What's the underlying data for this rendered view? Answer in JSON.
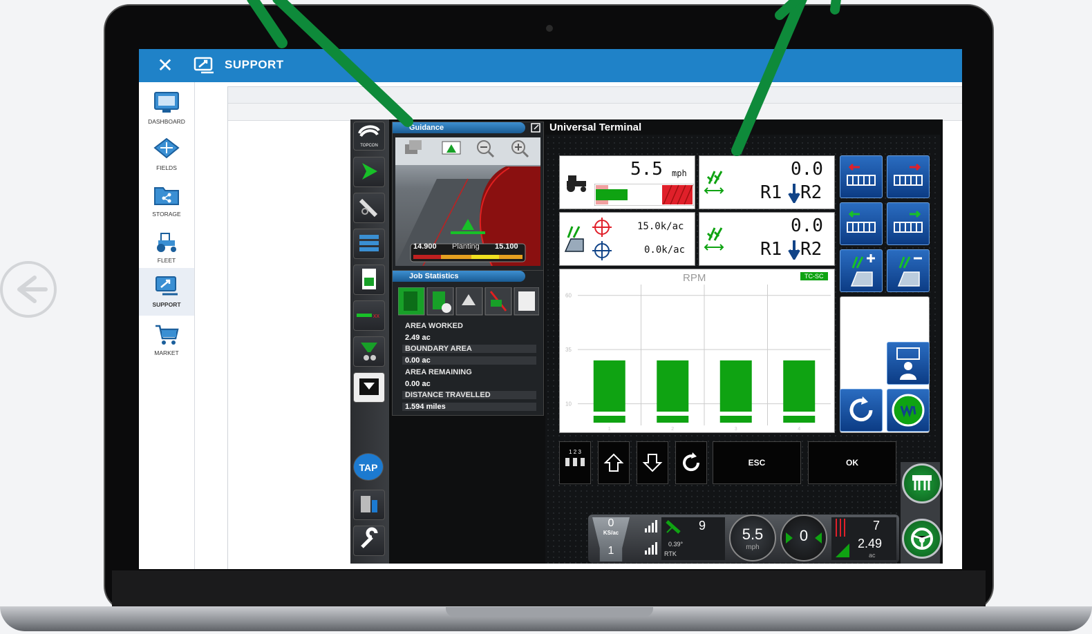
{
  "app": {
    "title": "SUPPORT",
    "sidebar": [
      {
        "label": "DASHBOARD",
        "icon": "monitor-icon"
      },
      {
        "label": "FIELDS",
        "icon": "fields-icon"
      },
      {
        "label": "STORAGE",
        "icon": "folder-share-icon"
      },
      {
        "label": "FLEET",
        "icon": "tractor-icon"
      },
      {
        "label": "SUPPORT",
        "icon": "support-icon",
        "active": true
      },
      {
        "label": "MARKET",
        "icon": "cart-icon"
      }
    ]
  },
  "console": {
    "brand": "TOPCON",
    "tap_label": "TAP",
    "guidance": {
      "title": "Guidance",
      "left_value": "14.900",
      "mode": "Planting",
      "right_value": "15.100"
    },
    "job_statistics": {
      "title": "Job Statistics",
      "rows": [
        {
          "label": "AREA WORKED",
          "value": "2.49 ac"
        },
        {
          "label": "BOUNDARY AREA",
          "value": "0.00 ac"
        },
        {
          "label": "AREA REMAINING",
          "value": "0.00 ac"
        },
        {
          "label": "DISTANCE TRAVELLED",
          "value": "1.594 miles"
        }
      ]
    },
    "universal_terminal": {
      "title": "Universal Terminal",
      "speed_value": "5.5",
      "speed_unit": "mph",
      "rate_r1_r2_top": {
        "value": "0.0",
        "label": "R1",
        "label2": "R2"
      },
      "rate_r1_r2_bottom": {
        "value": "0.0",
        "label": "R1",
        "label2": "R2"
      },
      "target_rate": "15.0k/ac",
      "actual_rate": "0.0k/ac",
      "rpm_chart": {
        "title": "RPM",
        "badge": "TC-SC",
        "y_ticks": [
          "60",
          "35",
          "10"
        ],
        "x_ticks": [
          "1",
          "2",
          "3",
          "4"
        ]
      },
      "softkeys": {
        "esc": "ESC",
        "ok": "OK",
        "section_numbers": "1 2 3"
      }
    },
    "status": {
      "rate_top": "0",
      "rate_unit": "KS/ac",
      "rate_bottom": "1",
      "satellites": "9",
      "heading": "0.39°",
      "fix_type": "RTK",
      "speed": "5.5",
      "speed_unit": "mph",
      "steer_value": "0",
      "count": "7",
      "area": "2.49",
      "area_unit": "ac"
    },
    "colors": {
      "accent_blue": "#1f82c8",
      "bar_green": "#0fa312",
      "alert_red": "#e0202a"
    }
  },
  "chart_data": {
    "type": "bar",
    "title": "RPM",
    "categories": [
      "1",
      "2",
      "3",
      "4"
    ],
    "values": [
      30,
      30,
      30,
      30
    ],
    "ylim": [
      0,
      65
    ],
    "y_ticks": [
      10,
      35,
      60
    ]
  }
}
